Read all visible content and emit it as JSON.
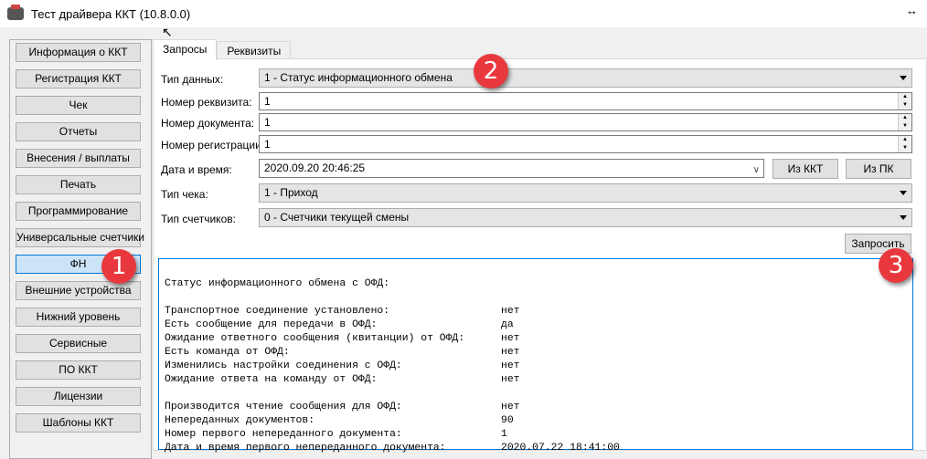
{
  "window": {
    "title": "Тест драйвера ККТ (10.8.0.0)",
    "resize_glyph": "↔",
    "cursor": "⇱"
  },
  "sidebar": {
    "items": [
      {
        "label": "Информация о ККТ"
      },
      {
        "label": "Регистрация ККТ"
      },
      {
        "label": "Чек"
      },
      {
        "label": "Отчеты"
      },
      {
        "label": "Внесения / выплаты"
      },
      {
        "label": "Печать"
      },
      {
        "label": "Программирование"
      },
      {
        "label": "Универсальные счетчики"
      },
      {
        "label": "ФН",
        "active": true
      },
      {
        "label": "Внешние устройства"
      },
      {
        "label": "Нижний уровень"
      },
      {
        "label": "Сервисные"
      },
      {
        "label": "ПО ККТ"
      },
      {
        "label": "Лицензии"
      },
      {
        "label": "Шаблоны ККТ"
      }
    ]
  },
  "tabs": [
    {
      "label": "Запросы",
      "active": true
    },
    {
      "label": "Реквизиты"
    }
  ],
  "form": {
    "data_type": {
      "label": "Тип данных:",
      "value": "1 - Статус информационного обмена"
    },
    "tag_number": {
      "label": "Номер реквизита:",
      "value": "1"
    },
    "doc_number": {
      "label": "Номер документа:",
      "value": "1"
    },
    "reg_number": {
      "label": "Номер регистрации:",
      "value": "1"
    },
    "datetime": {
      "label": "Дата и время:",
      "value": "2020.09.20 20:46:25",
      "from_kkt": "Из ККТ",
      "from_pc": "Из ПК"
    },
    "receipt_type": {
      "label": "Тип чека:",
      "value": "1 - Приход"
    },
    "counters_type": {
      "label": "Тип счетчиков:",
      "value": "0 - Счетчики текущей смены"
    },
    "request_button": "Запросить"
  },
  "output": {
    "header": "Статус информационного обмена с ОФД:",
    "rows1": [
      {
        "k": "Транспортное соединение установлено:",
        "v": "нет"
      },
      {
        "k": "Есть сообщение для передачи в ОФД:",
        "v": "да"
      },
      {
        "k": "Ожидание ответного сообщения (квитанции) от ОФД:",
        "v": "нет"
      },
      {
        "k": "Есть команда от ОФД:",
        "v": "нет"
      },
      {
        "k": "Изменились настройки соединения с ОФД:",
        "v": "нет"
      },
      {
        "k": "Ожидание ответа на команду от ОФД:",
        "v": "нет"
      }
    ],
    "rows2": [
      {
        "k": "Производится чтение сообщения для ОФД:",
        "v": "нет"
      },
      {
        "k": "Непереданных документов:",
        "v": "90"
      },
      {
        "k": "Номер первого непереданного документа:",
        "v": "1"
      },
      {
        "k": "Дата и время первого непереданного документа:",
        "v": "2020.07.22 18:41:00"
      }
    ]
  },
  "badges": [
    "1",
    "2",
    "3"
  ],
  "colors": {
    "badge": "#e8383d",
    "accent": "#0078d7"
  }
}
